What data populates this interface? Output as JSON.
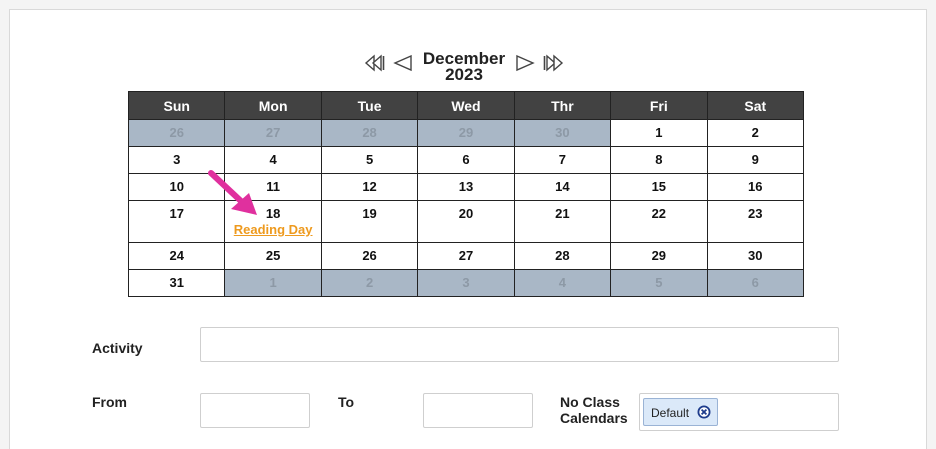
{
  "calendar": {
    "month": "December",
    "year": "2023",
    "nav": {
      "first_icon": "double-left-triangle-icon",
      "prev_icon": "left-triangle-icon",
      "next_icon": "right-triangle-icon",
      "last_icon": "double-right-triangle-icon"
    },
    "weekdays": [
      "Sun",
      "Mon",
      "Tue",
      "Wed",
      "Thr",
      "Fri",
      "Sat"
    ],
    "weeks": [
      {
        "days": [
          {
            "num": "26",
            "other": true
          },
          {
            "num": "27",
            "other": true
          },
          {
            "num": "28",
            "other": true
          },
          {
            "num": "29",
            "other": true
          },
          {
            "num": "30",
            "other": true
          },
          {
            "num": "1"
          },
          {
            "num": "2"
          }
        ]
      },
      {
        "days": [
          {
            "num": "3"
          },
          {
            "num": "4"
          },
          {
            "num": "5"
          },
          {
            "num": "6"
          },
          {
            "num": "7"
          },
          {
            "num": "8"
          },
          {
            "num": "9"
          }
        ]
      },
      {
        "days": [
          {
            "num": "10"
          },
          {
            "num": "11"
          },
          {
            "num": "12"
          },
          {
            "num": "13"
          },
          {
            "num": "14"
          },
          {
            "num": "15"
          },
          {
            "num": "16"
          }
        ]
      },
      {
        "days": [
          {
            "num": "17"
          },
          {
            "num": "18",
            "event": "Reading Day"
          },
          {
            "num": "19"
          },
          {
            "num": "20"
          },
          {
            "num": "21"
          },
          {
            "num": "22"
          },
          {
            "num": "23"
          }
        ]
      },
      {
        "days": [
          {
            "num": "24"
          },
          {
            "num": "25"
          },
          {
            "num": "26"
          },
          {
            "num": "27"
          },
          {
            "num": "28"
          },
          {
            "num": "29"
          },
          {
            "num": "30"
          }
        ]
      },
      {
        "days": [
          {
            "num": "31"
          },
          {
            "num": "1",
            "other": true
          },
          {
            "num": "2",
            "other": true
          },
          {
            "num": "3",
            "other": true
          },
          {
            "num": "4",
            "other": true
          },
          {
            "num": "5",
            "other": true
          },
          {
            "num": "6",
            "other": true
          }
        ]
      }
    ],
    "colors": {
      "header_bg": "#424242",
      "other_month_bg": "#a9b7c6",
      "event_link": "#ee9a1e",
      "arrow": "#e0309e"
    }
  },
  "form": {
    "activity_label": "Activity",
    "activity_value": "",
    "from_label": "From",
    "from_value": "",
    "to_label": "To",
    "to_value": "",
    "no_class_label_line1": "No Class",
    "no_class_label_line2": "Calendars",
    "no_class_tags": [
      {
        "label": "Default",
        "remove_icon": "circle-x-icon"
      }
    ]
  }
}
